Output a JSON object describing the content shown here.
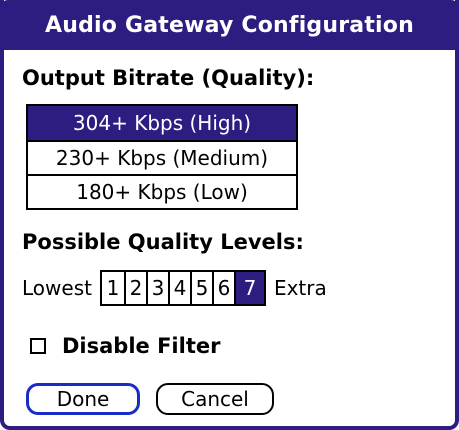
{
  "dialog": {
    "title": "Audio Gateway Configuration"
  },
  "output_bitrate": {
    "heading": "Output Bitrate (Quality):",
    "options": [
      {
        "label": "304+ Kbps (High)",
        "selected": true
      },
      {
        "label": "230+ Kbps (Medium)",
        "selected": false
      },
      {
        "label": "180+ Kbps (Low)",
        "selected": false
      }
    ]
  },
  "quality_levels": {
    "heading": "Possible Quality Levels:",
    "lowest_label": "Lowest",
    "extra_label": "Extra",
    "levels": [
      "1",
      "2",
      "3",
      "4",
      "5",
      "6",
      "7"
    ],
    "selected_level": "7"
  },
  "filter": {
    "label": "Disable Filter",
    "checked": false
  },
  "buttons": {
    "done_label": "Done",
    "cancel_label": "Cancel"
  },
  "colors": {
    "accent": "#2d1d80",
    "focus_ring": "#1a2cc8"
  }
}
